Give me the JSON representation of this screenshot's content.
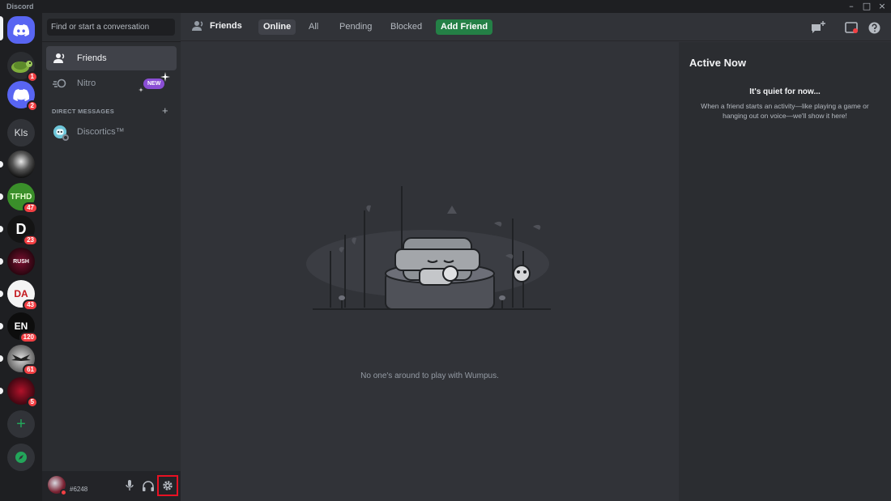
{
  "window": {
    "title": "Discord"
  },
  "guilds": [
    {
      "name": "home",
      "kind": "home"
    },
    {
      "name": "turtle",
      "badge": "1"
    },
    {
      "name": "discord-blue",
      "badge": "2"
    },
    {
      "name": "kls",
      "label": "Kls"
    },
    {
      "name": "dark-figure"
    },
    {
      "name": "tfhd",
      "label": "TFHD",
      "badge": "47"
    },
    {
      "name": "d-server",
      "label": "D",
      "badge": "23"
    },
    {
      "name": "rush",
      "label": "RUSH"
    },
    {
      "name": "da",
      "label": "DA",
      "badge": "43"
    },
    {
      "name": "en",
      "label": "EN",
      "badge": "120"
    },
    {
      "name": "wings",
      "badge": "61"
    },
    {
      "name": "red-esports",
      "badge": "5"
    }
  ],
  "sidebar": {
    "search_placeholder": "Find or start a conversation",
    "friends_label": "Friends",
    "nitro_label": "Nitro",
    "nitro_badge": "NEW",
    "dm_header": "DIRECT MESSAGES",
    "dm_add": "+",
    "dms": [
      {
        "name": "Discortics™"
      }
    ]
  },
  "user": {
    "tag": "#6248"
  },
  "topbar": {
    "title": "Friends",
    "tabs": [
      {
        "label": "Online",
        "selected": true
      },
      {
        "label": "All"
      },
      {
        "label": "Pending"
      },
      {
        "label": "Blocked"
      }
    ],
    "add_friend": "Add Friend"
  },
  "main": {
    "empty_text": "No one's around to play with Wumpus."
  },
  "active_now": {
    "title": "Active Now",
    "quiet_title": "It's quiet for now...",
    "quiet_desc": "When a friend starts an activity—like playing a game or hanging out on voice—we'll show it here!"
  },
  "colors": {
    "blurple": "#5865f2",
    "green": "#248046",
    "red": "#f23f43",
    "nitro_purple": "#8a4ed4",
    "highlight": "#e81123"
  }
}
